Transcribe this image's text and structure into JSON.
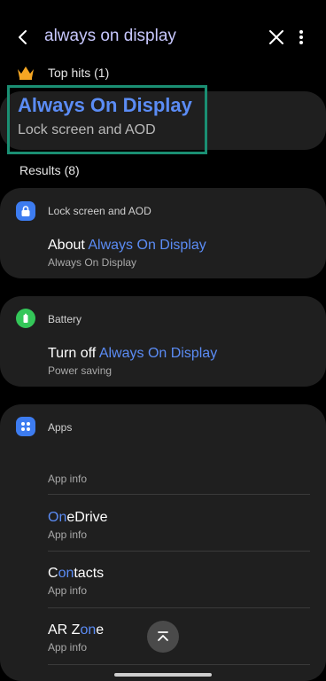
{
  "search": {
    "query": "always on display"
  },
  "top_hits": {
    "label": "Top hits (1)",
    "item": {
      "title": "Always On Display",
      "subtitle": "Lock screen and AOD"
    }
  },
  "results": {
    "label": "Results (8)",
    "groups": [
      {
        "category": "Lock screen and AOD",
        "icon": "lock-icon",
        "items": [
          {
            "prefix": "About ",
            "highlight": "Always On Display",
            "suffix": "",
            "subtitle": "Always On Display"
          }
        ]
      },
      {
        "category": "Battery",
        "icon": "battery-icon",
        "items": [
          {
            "prefix": "Turn off ",
            "highlight": "Always On Display",
            "suffix": "",
            "subtitle": "Power saving"
          }
        ]
      },
      {
        "category": "Apps",
        "icon": "apps-icon",
        "items": [
          {
            "subtitle": "App info"
          },
          {
            "prefix": "",
            "highlight": "On",
            "suffix": "eDrive",
            "subtitle": "App info"
          },
          {
            "prefix": "C",
            "highlight": "on",
            "suffix": "tacts",
            "subtitle": "App info"
          },
          {
            "prefix": "AR Z",
            "highlight": "on",
            "suffix": "e",
            "subtitle": "App info"
          }
        ]
      }
    ]
  },
  "colors": {
    "accent": "#5b8cf5",
    "highlight_border": "#1a8f73",
    "card_bg": "#1f1f1f",
    "crown": "#f5a623",
    "battery": "#34c759",
    "lock_blue": "#3d7cf0",
    "apps_blue": "#3d7cf0"
  }
}
